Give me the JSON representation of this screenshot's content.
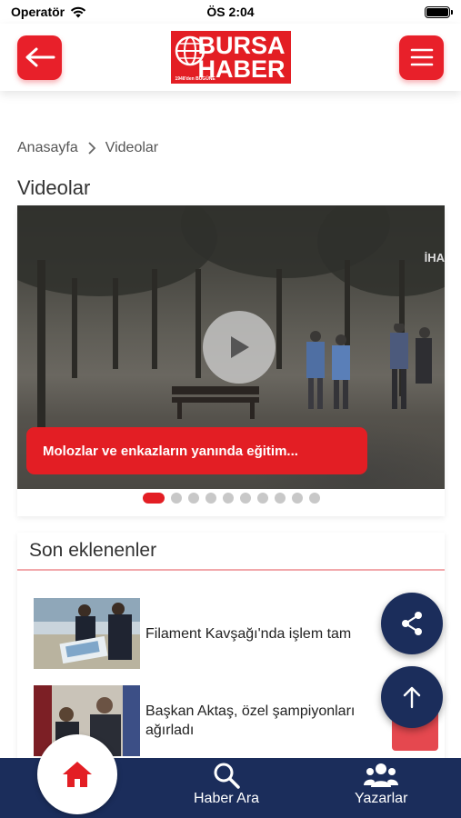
{
  "status_bar": {
    "carrier": "Operatör",
    "time": "ÖS 2:04"
  },
  "header": {
    "logo_line1": "BURSA",
    "logo_line2": "HABER",
    "logo_since": "1948'den BUGÜNE"
  },
  "breadcrumb": {
    "home": "Anasayfa",
    "current": "Videolar"
  },
  "page_title": "Videolar",
  "video_slider": {
    "caption": "Molozlar ve enkazların yanında eğitim...",
    "watermark": "İHA",
    "dot_count": 10,
    "active_index": 0
  },
  "recent": {
    "title": "Son eklenenler",
    "items": [
      {
        "title": "Filament Kavşağı'nda işlem tam"
      },
      {
        "title": "Başkan Aktaş, özel şampiyonları ağırladı"
      }
    ]
  },
  "bottom_nav": {
    "home": "",
    "search": "Haber Ara",
    "authors": "Yazarlar"
  },
  "colors": {
    "brand_red": "#e31e24",
    "navy": "#1b2d5b"
  },
  "icons": {
    "back": "arrow-left-icon",
    "menu": "hamburger-menu-icon",
    "play": "play-icon",
    "share": "share-icon",
    "scroll_top": "arrow-up-icon",
    "home": "home-icon",
    "search": "search-icon",
    "authors": "users-icon",
    "chevron": "chevron-right-icon"
  }
}
